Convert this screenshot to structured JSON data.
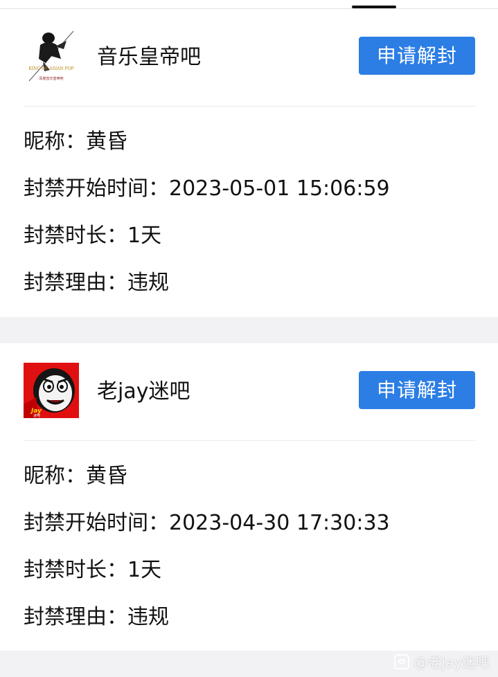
{
  "bans": [
    {
      "forum": {
        "name": "音乐皇帝吧",
        "avatar_icon": "king-of-asian-pop-avatar-icon",
        "avatar_caption": "KING OF ASIAN POP",
        "avatar_subcaption": "百度音乐皇帝吧"
      },
      "appeal_label": "申请解封",
      "rows": [
        {
          "label": "昵称：",
          "value": "黄昏"
        },
        {
          "label": "封禁开始时间：",
          "value": "2023-05-01 15:06:59"
        },
        {
          "label": "封禁时长：",
          "value": "1天"
        },
        {
          "label": "封禁理由：",
          "value": "违规"
        }
      ]
    },
    {
      "forum": {
        "name": "老jay迷吧",
        "avatar_icon": "jay-fan-avatar-icon",
        "avatar_caption": "Jay",
        "avatar_subcaption": "迷吧"
      },
      "appeal_label": "申请解封",
      "rows": [
        {
          "label": "昵称：",
          "value": "黄昏"
        },
        {
          "label": "封禁开始时间：",
          "value": "2023-04-30 17:30:33"
        },
        {
          "label": "封禁时长：",
          "value": "1天"
        },
        {
          "label": "封禁理由：",
          "value": "违规"
        }
      ]
    }
  ],
  "watermark": {
    "text": "@老jay迷吧",
    "icon": "tieba-logo-icon"
  },
  "colors": {
    "accent": "#2c7ee5",
    "background": "#f2f2f5",
    "card": "#ffffff"
  }
}
